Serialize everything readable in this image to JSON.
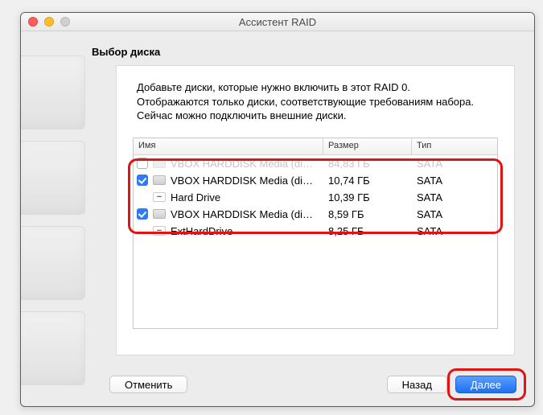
{
  "window": {
    "title": "Ассистент RAID"
  },
  "heading": "Выбор диска",
  "intro": {
    "line1": "Добавьте диски, которые нужно включить в этот RAID 0.",
    "line2": "Отображаются только диски, соответствующие требованиям набора.",
    "line3": "Сейчас можно подключить внешние диски."
  },
  "columns": {
    "name": "Имя",
    "size": "Размер",
    "type": "Тип"
  },
  "rows": [
    {
      "checked": false,
      "dim": true,
      "icon": "disk",
      "name": "VBOX HARDDISK Media (di…",
      "size": "84,83 ГБ",
      "type": "SATA"
    },
    {
      "checked": true,
      "dim": false,
      "icon": "disk",
      "name": "VBOX HARDDISK Media (di…",
      "size": "10,74 ГБ",
      "type": "SATA"
    },
    {
      "checked": null,
      "dim": false,
      "icon": "minus",
      "name": "Hard Drive",
      "size": "10,39 ГБ",
      "type": "SATA"
    },
    {
      "checked": true,
      "dim": false,
      "icon": "disk",
      "name": "VBOX HARDDISK Media (di…",
      "size": "8,59 ГБ",
      "type": "SATA"
    },
    {
      "checked": null,
      "dim": false,
      "icon": "minus",
      "name": "ExtHardDrive",
      "size": "8,25 ГБ",
      "type": "SATA"
    }
  ],
  "buttons": {
    "cancel": "Отменить",
    "back": "Назад",
    "next": "Далее"
  }
}
